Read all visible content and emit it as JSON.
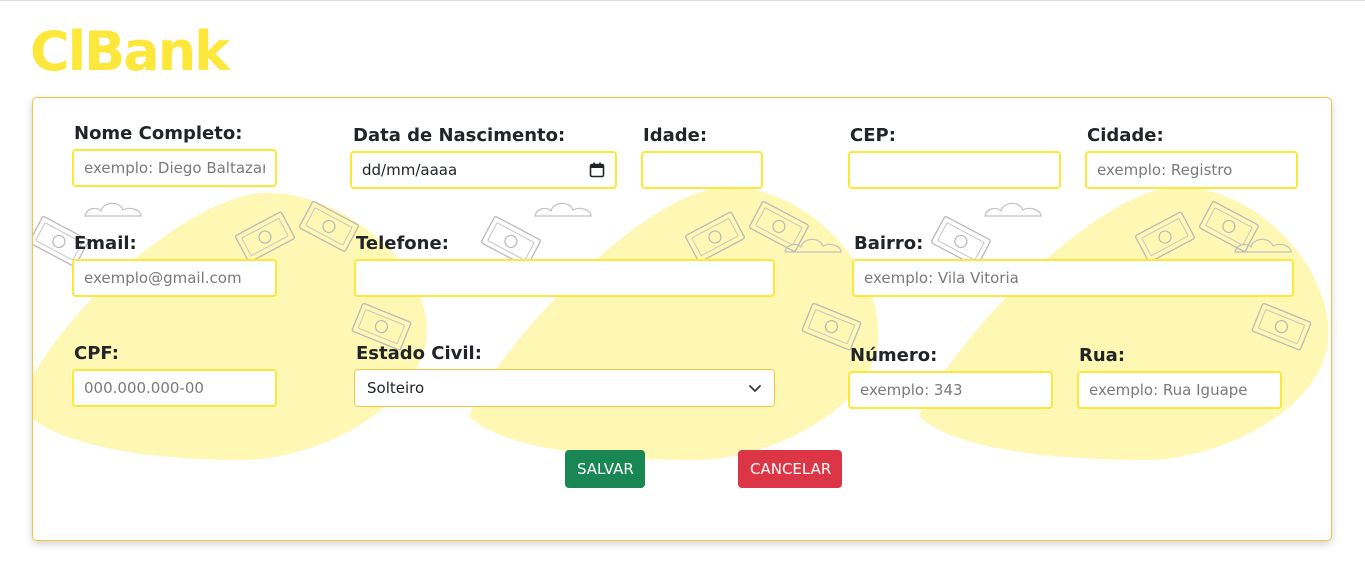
{
  "app": {
    "logo": "ClBank"
  },
  "form": {
    "nome": {
      "label": "Nome Completo:",
      "placeholder": "exemplo: Diego Baltazar"
    },
    "nascimento": {
      "label": "Data de Nascimento:",
      "value": "dd/mm/aaaa"
    },
    "idade": {
      "label": "Idade:",
      "placeholder": ""
    },
    "cep": {
      "label": "CEP:",
      "placeholder": ""
    },
    "cidade": {
      "label": "Cidade:",
      "placeholder": "exemplo: Registro"
    },
    "email": {
      "label": "Email:",
      "placeholder": "exemplo@gmail.com"
    },
    "telefone": {
      "label": "Telefone:",
      "placeholder": ""
    },
    "bairro": {
      "label": "Bairro:",
      "placeholder": "exemplo: Vila Vitoria"
    },
    "cpf": {
      "label": "CPF:",
      "placeholder": "000.000.000-00"
    },
    "estado_civil": {
      "label": "Estado Civil:",
      "selected": "Solteiro"
    },
    "numero": {
      "label": "Número:",
      "placeholder": "exemplo: 343"
    },
    "rua": {
      "label": "Rua:",
      "placeholder": "exemplo: Rua Iguape"
    }
  },
  "buttons": {
    "save": "SALVAR",
    "cancel": "CANCELAR"
  },
  "icons": {
    "date": "calendar-icon",
    "select": "chevron-down-icon",
    "decor": [
      "money-bill-icon",
      "cloud-icon"
    ]
  },
  "colors": {
    "brand": "#fde73a",
    "border": "#f5c542",
    "save": "#198754",
    "cancel": "#dc3545",
    "blob": "#fef8b4"
  }
}
